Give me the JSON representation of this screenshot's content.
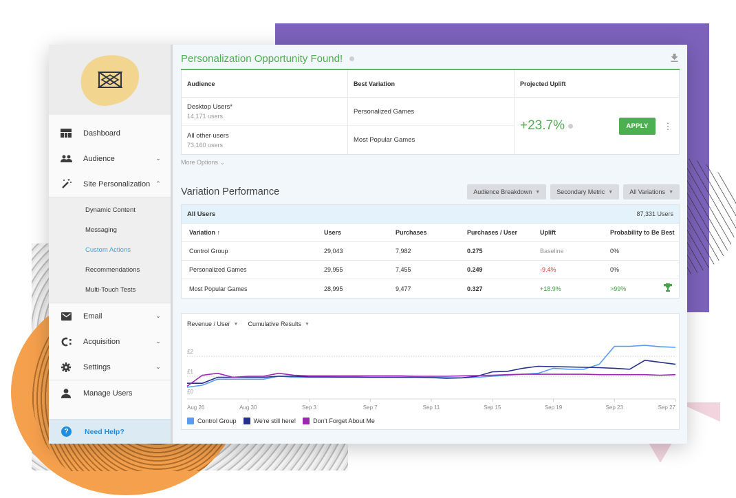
{
  "sidebar": {
    "logo": "logo-bowtie-icon",
    "items": [
      {
        "label": "Dashboard",
        "icon": "dashboard-icon",
        "chevron": ""
      },
      {
        "label": "Audience",
        "icon": "audience-icon",
        "chevron": "⌄"
      },
      {
        "label": "Site Personalization",
        "icon": "magic-wand-icon",
        "chevron": "⌃"
      },
      {
        "label": "Email",
        "icon": "email-icon",
        "chevron": "⌄"
      },
      {
        "label": "Acquisition",
        "icon": "acquisition-icon",
        "chevron": "⌄"
      },
      {
        "label": "Settings",
        "icon": "gear-icon",
        "chevron": "⌄"
      },
      {
        "label": "Manage Users",
        "icon": "user-icon",
        "chevron": ""
      }
    ],
    "subitems": [
      {
        "label": "Dynamic Content",
        "active": false
      },
      {
        "label": "Messaging",
        "active": false
      },
      {
        "label": "Custom Actions",
        "active": true
      },
      {
        "label": "Recommendations",
        "active": false
      },
      {
        "label": "Multi-Touch Tests",
        "active": false
      }
    ],
    "help_label": "Need Help?",
    "help_icon_glyph": "?"
  },
  "opportunity": {
    "title": "Personalization Opportunity Found!",
    "columns": [
      "Audience",
      "Best Variation",
      "Projected Uplift"
    ],
    "rows": [
      {
        "audience": "Desktop Users*",
        "users": "14,171 users",
        "best_variation": "Personalized Games"
      },
      {
        "audience": "All other users",
        "users": "73,160 users",
        "best_variation": "Most Popular Games"
      }
    ],
    "projected_uplift": "+23.7%",
    "apply_label": "APPLY",
    "more_options": "More Options ⌄"
  },
  "variation_performance": {
    "title": "Variation Performance",
    "dropdowns": [
      "Audience Breakdown",
      "Secondary Metric",
      "All Variations"
    ],
    "segment": "All Users",
    "segment_count": "87,331 Users",
    "columns": [
      "Variation ↑",
      "Users",
      "Purchases",
      "Purchases / User",
      "Uplift",
      "Probability to Be Best"
    ],
    "rows": [
      {
        "variation": "Control Group",
        "users": "29,043",
        "purchases": "7,982",
        "ppu": "0.275",
        "uplift": "Baseline",
        "uplift_type": "base",
        "prob": "0%",
        "winner": false
      },
      {
        "variation": "Personalized Games",
        "users": "29,955",
        "purchases": "7,455",
        "ppu": "0.249",
        "uplift": "-9.4%",
        "uplift_type": "neg",
        "prob": "0%",
        "winner": false
      },
      {
        "variation": "Most Popular Games",
        "users": "28,995",
        "purchases": "9,477",
        "ppu": "0.327",
        "uplift": "+18.9%",
        "uplift_type": "pos",
        "prob": ">99%",
        "winner": true
      }
    ]
  },
  "chart_controls": {
    "metric": "Revenue / User",
    "mode": "Cumulative Results"
  },
  "colors": {
    "accent_green": "#4caf50",
    "link_blue": "#3aa0e0",
    "control_group": "#5b9cf0",
    "still_here": "#26328a",
    "dont_forget": "#9c27b0"
  },
  "chart_data": {
    "type": "line",
    "title": "Revenue / User",
    "xlabel": "",
    "ylabel": "",
    "y_ticks": [
      "£0",
      "£1",
      "£2"
    ],
    "ylim": [
      0,
      2.6
    ],
    "x_ticks": [
      "Aug 26",
      "Aug 30",
      "Sep 3",
      "Sep 7",
      "Sep 11",
      "Sep 15",
      "Sep 19",
      "Sep 23",
      "Sep 27"
    ],
    "x_tick_day_index": [
      0,
      4,
      8,
      12,
      16,
      20,
      24,
      28,
      32
    ],
    "grid": true,
    "legend_position": "bottom-left",
    "series": [
      {
        "name": "Control Group",
        "color": "#5b9cf0",
        "values": [
          0.45,
          0.55,
          0.85,
          0.85,
          0.85,
          0.85,
          1.0,
          0.95,
          0.95,
          0.95,
          0.95,
          0.95,
          0.95,
          0.95,
          0.95,
          0.95,
          0.95,
          0.93,
          0.92,
          0.95,
          1.0,
          1.05,
          1.1,
          1.15,
          1.4,
          1.35,
          1.35,
          1.6,
          2.5,
          2.5,
          2.55,
          2.48,
          2.45
        ]
      },
      {
        "name": "We're still here!",
        "color": "#26328a",
        "values": [
          0.65,
          0.65,
          0.95,
          0.95,
          0.95,
          0.95,
          1.0,
          1.0,
          0.97,
          0.97,
          0.96,
          0.96,
          0.95,
          0.95,
          0.95,
          0.95,
          0.93,
          0.9,
          0.92,
          1.0,
          1.22,
          1.25,
          1.4,
          1.5,
          1.48,
          1.47,
          1.45,
          1.43,
          1.4,
          1.35,
          1.8,
          1.7,
          1.6
        ]
      },
      {
        "name": "Don't Forget About Me",
        "color": "#9c27b0",
        "values": [
          0.5,
          1.05,
          1.15,
          0.95,
          1.0,
          1.0,
          1.15,
          1.05,
          1.02,
          1.02,
          1.02,
          1.02,
          1.02,
          1.02,
          1.02,
          1.0,
          1.0,
          1.0,
          1.02,
          1.03,
          1.05,
          1.08,
          1.1,
          1.1,
          1.1,
          1.1,
          1.1,
          1.08,
          1.08,
          1.08,
          1.08,
          1.05,
          1.08
        ]
      }
    ]
  }
}
